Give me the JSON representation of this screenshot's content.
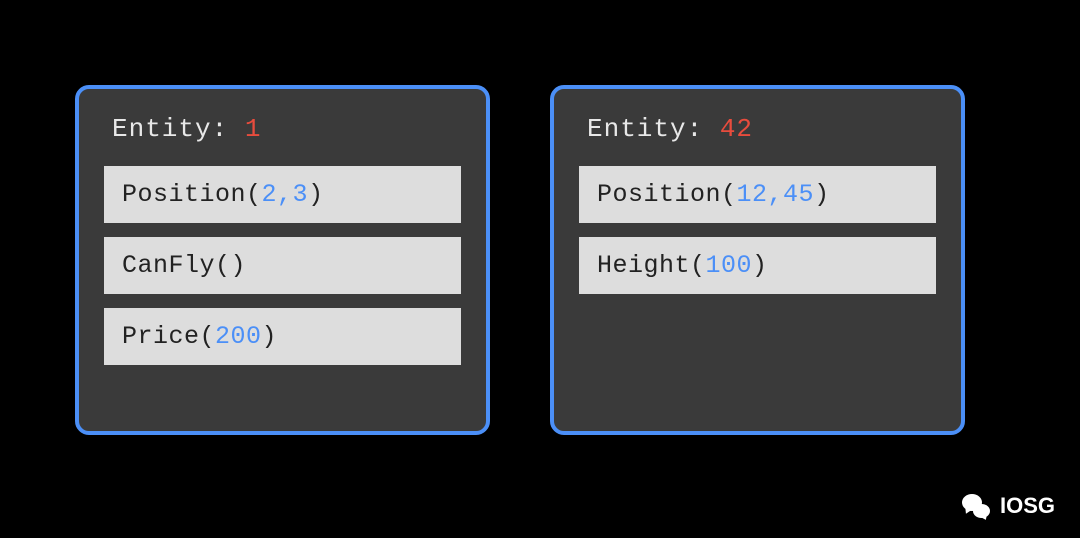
{
  "entities": [
    {
      "label": "Entity: ",
      "id": "1",
      "components": [
        {
          "name": "Position",
          "args": "2,3"
        },
        {
          "name": "CanFly",
          "args": ""
        },
        {
          "name": "Price",
          "args": "200"
        }
      ]
    },
    {
      "label": "Entity: ",
      "id": "42",
      "components": [
        {
          "name": "Position",
          "args": "12,45"
        },
        {
          "name": "Height",
          "args": "100"
        }
      ]
    }
  ],
  "watermark": {
    "text": "IOSG"
  }
}
